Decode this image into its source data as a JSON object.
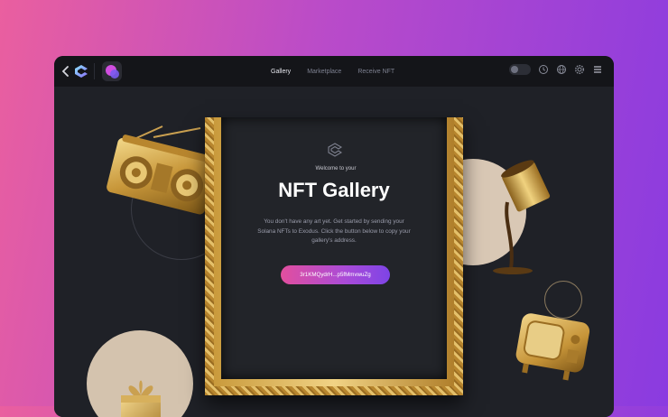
{
  "nav": {
    "tabs": [
      "Gallery",
      "Marketplace",
      "Receive NFT"
    ],
    "active_tab": "Gallery"
  },
  "panel": {
    "welcome": "Welcome to your",
    "title": "NFT Gallery",
    "description": "You don't have any art yet. Get started by sending your Solana NFTs to Exodus. Click the button below to copy your gallery's address.",
    "address_button": "3r1KMQydrH...p5fMmvwuZg"
  },
  "icons": {
    "back": "chevron-left-icon",
    "logo": "exodus-logo-icon",
    "app": "nft-app-icon",
    "toggle": "lock-toggle-icon",
    "history": "history-icon",
    "globe": "globe-icon",
    "settings": "gear-icon",
    "menu": "menu-icon"
  },
  "colors": {
    "accent_start": "#e24f9e",
    "accent_end": "#7e44e6",
    "gold": "#d4a84a"
  }
}
